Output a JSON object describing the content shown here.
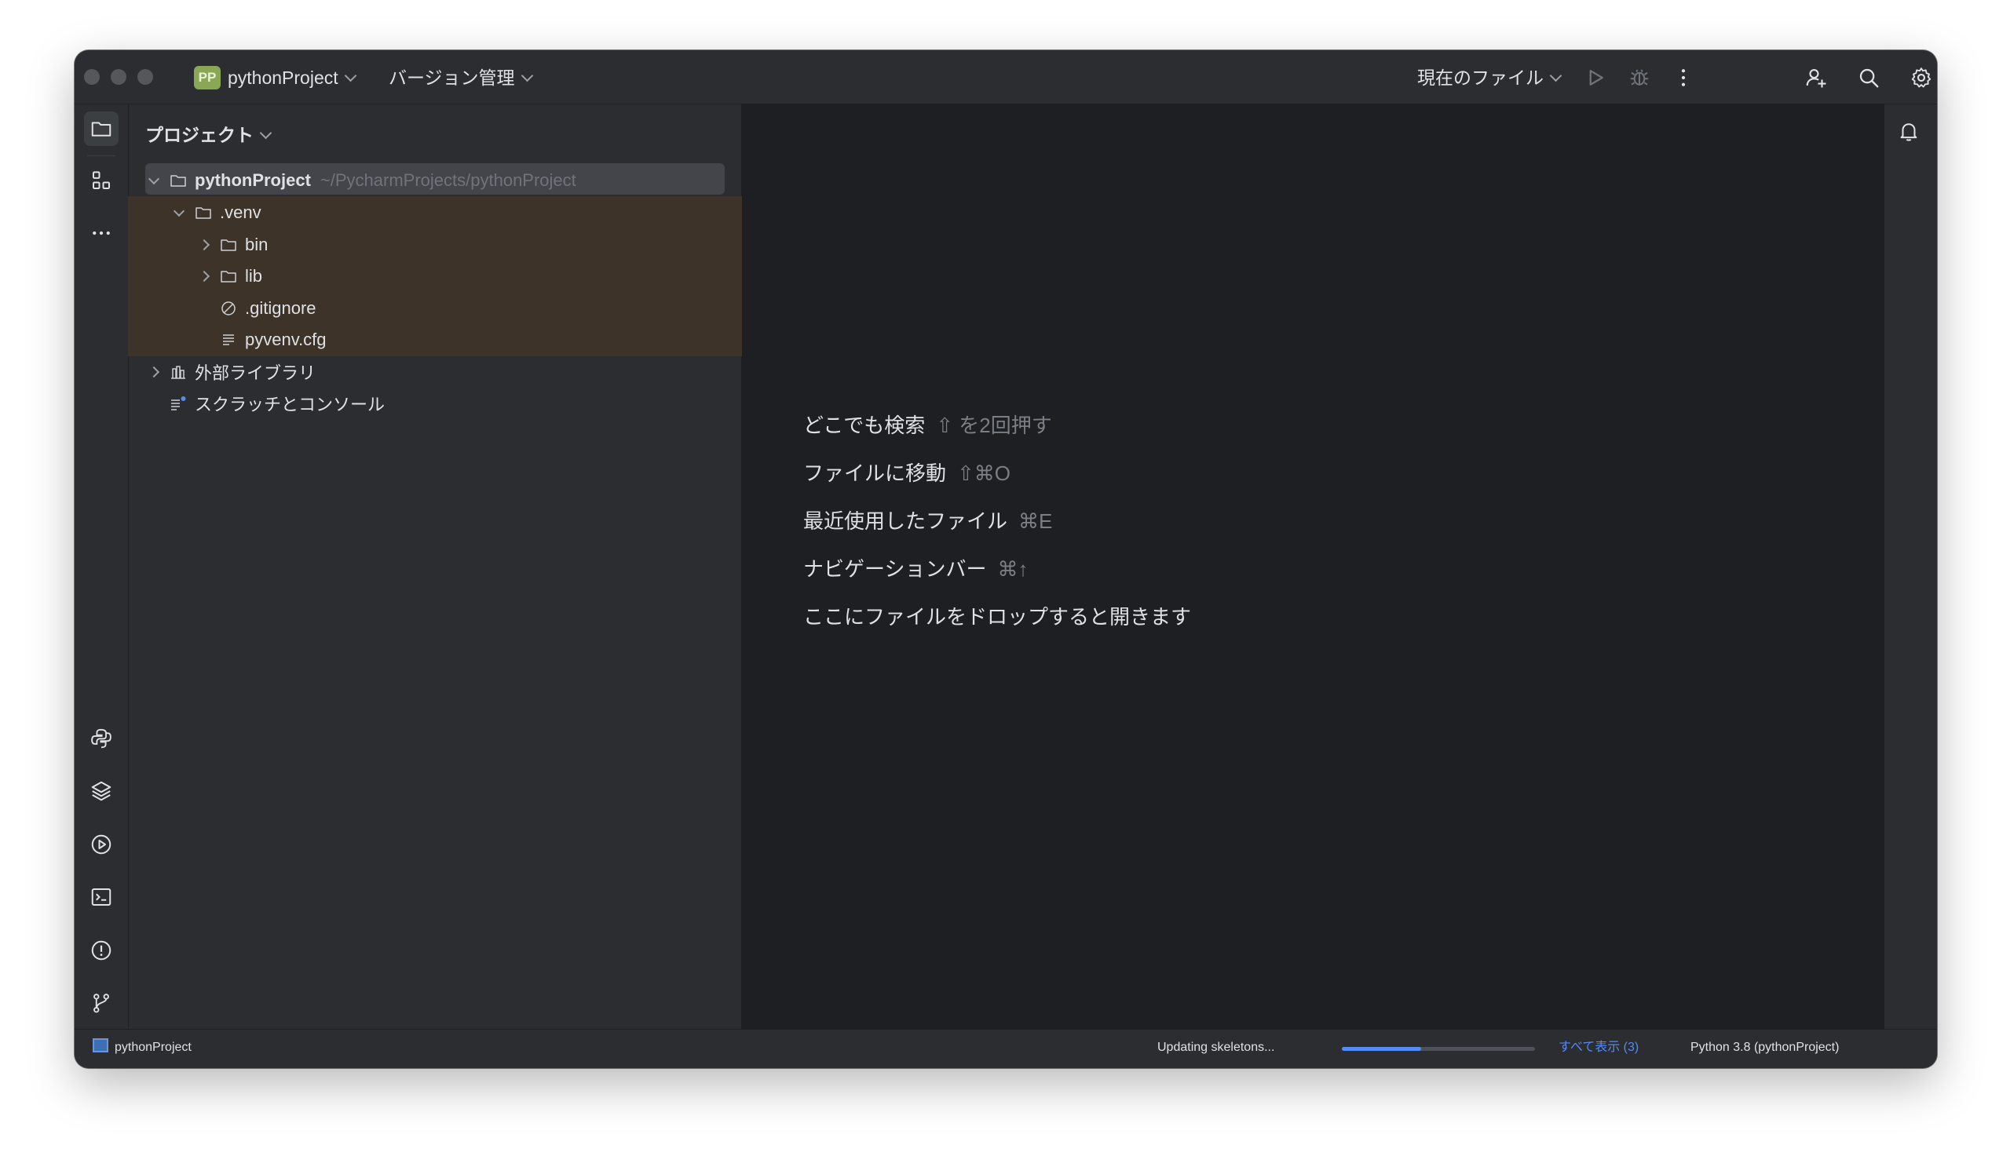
{
  "titlebar": {
    "project_badge": "PP",
    "project_name": "pythonProject",
    "vcs_label": "バージョン管理",
    "run_config": "現在のファイル"
  },
  "project_panel": {
    "title": "プロジェクト",
    "tree": {
      "root_name": "pythonProject",
      "root_path": "~/PycharmProjects/pythonProject",
      "venv": ".venv",
      "bin": "bin",
      "lib": "lib",
      "gitignore": ".gitignore",
      "pyvenv": "pyvenv.cfg",
      "external_libs": "外部ライブラリ",
      "scratches": "スクラッチとコンソール"
    }
  },
  "editor": {
    "hints": [
      {
        "label": "どこでも検索",
        "key": "⇧ を2回押す"
      },
      {
        "label": "ファイルに移動",
        "key": "⇧⌘O"
      },
      {
        "label": "最近使用したファイル",
        "key": "⌘E"
      },
      {
        "label": "ナビゲーションバー",
        "key": "⌘↑"
      },
      {
        "label": "ここにファイルをドロップすると開きます",
        "key": ""
      }
    ]
  },
  "statusbar": {
    "project": "pythonProject",
    "task": "Updating skeletons...",
    "progress": 0.41,
    "show_all": "すべて表示 (3)",
    "interpreter": "Python 3.8 (pythonProject)"
  },
  "colors": {
    "accent": "#548af7",
    "badge": "#8aa756",
    "excluded": "#3d3328",
    "selection": "#43454a"
  },
  "icons": {
    "titlebar": [
      "run-icon",
      "debug-icon",
      "more-vertical-icon",
      "add-user-icon",
      "search-icon",
      "settings-icon"
    ],
    "left_strip": [
      "folder-icon",
      "structure-icon",
      "more-horizontal-icon",
      "python-console-icon",
      "layers-icon",
      "services-icon",
      "terminal-icon",
      "problems-icon",
      "git-icon"
    ],
    "right_strip": [
      "notifications-icon"
    ]
  }
}
